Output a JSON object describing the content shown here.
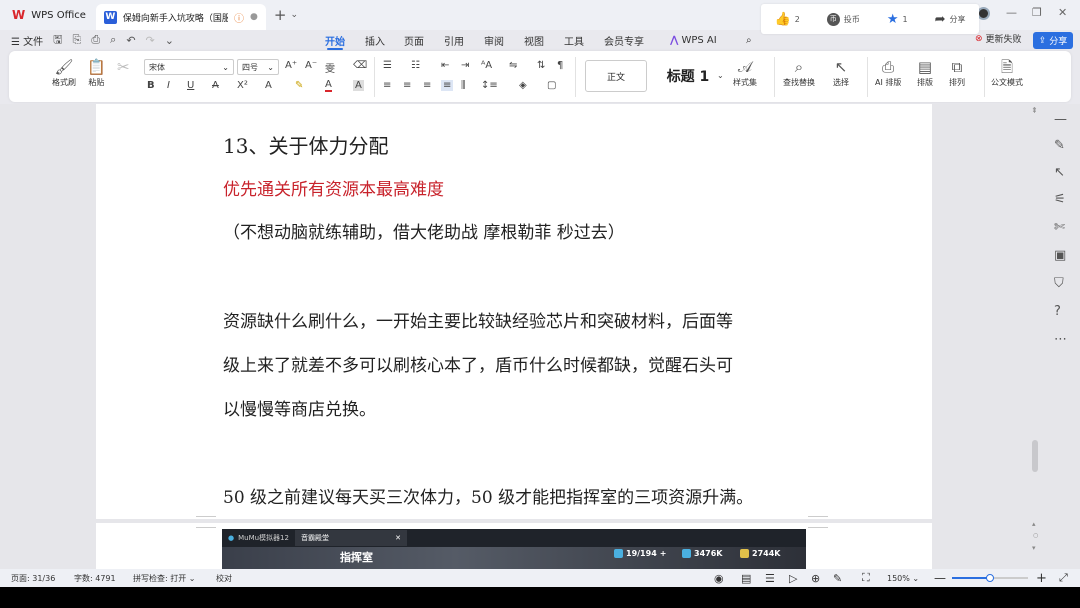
{
  "tabs": {
    "app_label": "WPS Office",
    "doc_title": "保姆向新手入坑攻略（国服）"
  },
  "social": {
    "like_count": "2",
    "coin_label": "投币",
    "fav_count": "1",
    "share_label": "分享"
  },
  "menubar": {
    "file_label": "文件",
    "items": [
      "开始",
      "插入",
      "页面",
      "引用",
      "审阅",
      "视图",
      "工具",
      "会员专享",
      "WPS AI"
    ],
    "active": "开始",
    "update_label": "更新失败",
    "share_label": "分享"
  },
  "ribbon": {
    "format_painter": "格式刷",
    "paste": "粘贴",
    "font_name": "宋体",
    "font_size": "四号",
    "style_normal": "正文",
    "style_heading": "标题 1",
    "style_set": "样式集",
    "find_replace": "查找替换",
    "select": "选择",
    "ai_layout": "AI 排版",
    "layout": "排版",
    "arrange": "排列",
    "official": "公文模式"
  },
  "document": {
    "heading": "13、关于体力分配",
    "red_line": "优先通关所有资源本最高难度",
    "paren_line": "（不想动脑就练辅助，借大佬助战 摩根勒菲 秒过去）",
    "para1_l1": "资源缺什么刷什么，一开始主要比较缺经验芯片和突破材料，后面等",
    "para1_l2": "级上来了就差不多可以刷核心本了，盾币什么时候都缺，觉醒石头可",
    "para1_l3": "以慢慢等商店兑换。",
    "para2": "50 级之前建议每天买三次体力，50 级才能把指挥室的三项资源升满。"
  },
  "embed": {
    "app_tab": "MuMu模拟器12",
    "game_tab": "音霸殿堂",
    "screen_title": "指挥室",
    "stat1": "19/194",
    "stat2": "3476K",
    "stat3": "2744K"
  },
  "status": {
    "page": "页面: 31/36",
    "words": "字数: 4791",
    "spell": "拼写检查: 打开",
    "proof": "校对",
    "zoom": "150%",
    "zoom_level": 0.5
  },
  "colors": {
    "accent": "#2b6fe0",
    "red_text": "#c8232c",
    "wps_red": "#d9262c"
  }
}
